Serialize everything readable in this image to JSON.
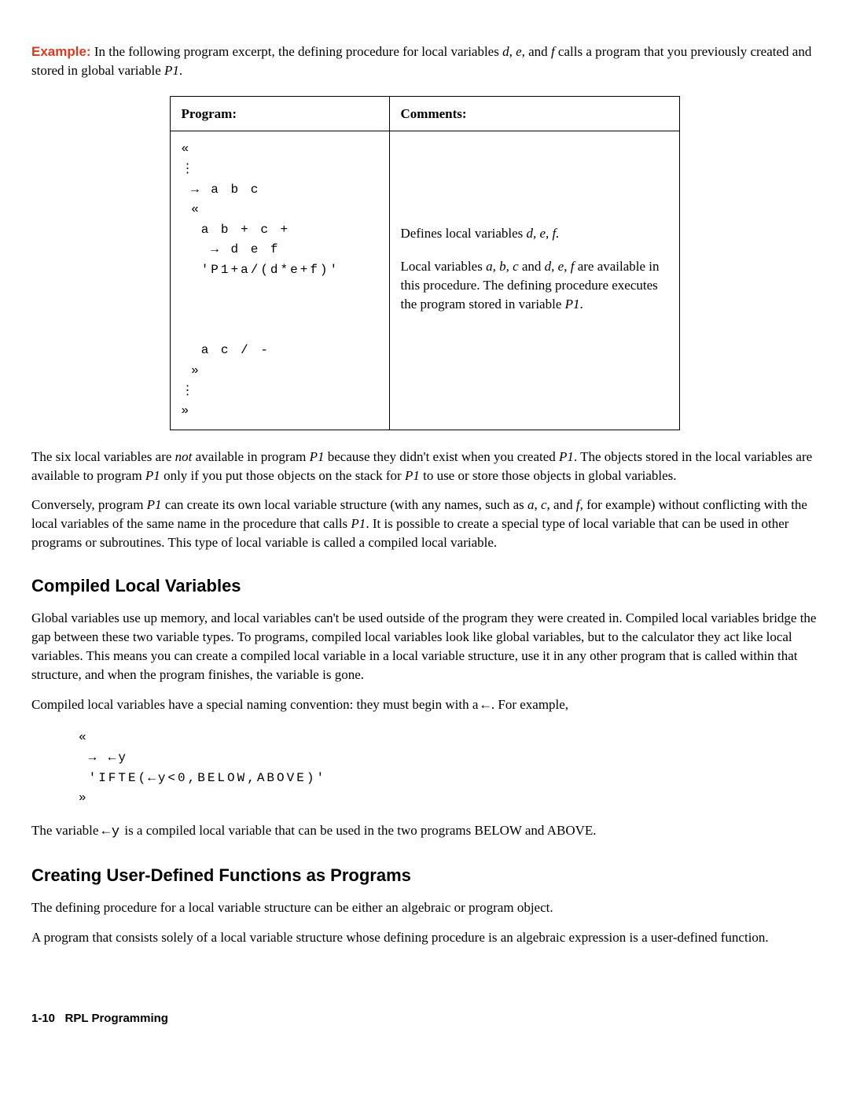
{
  "example": {
    "label": "Example:",
    "intro_1": " In the following program excerpt, the defining procedure for local variables ",
    "var_d": "d",
    "comma1": ", ",
    "var_e": "e",
    "comma2": ", and ",
    "var_f": "f",
    "intro_2": " calls a program that you previously created and stored in global variable ",
    "var_p1": "P1",
    "period": "."
  },
  "table": {
    "header_program": "Program:",
    "header_comments": "Comments:",
    "program_code": "«\n⋮\n → a b c\n «\n  a b + c +\n   → d e f\n  'P1+a/(d*e+f)'\n\n\n\n  a c / -\n »\n⋮\n»",
    "comment_line1_pre": "Defines local variables ",
    "comment_line1_vars": "d, e, f.",
    "comment_line2_pre": "Local variables ",
    "comment_line2_abc": "a, b, c",
    "comment_line2_mid": " and ",
    "comment_line2_def": "d, e, f",
    "comment_line2_post": " are available in this procedure. The defining procedure executes the program stored in variable ",
    "comment_line2_p1": "P1",
    "comment_line2_end": "."
  },
  "para1": {
    "t1": "The six local variables are ",
    "not": "not",
    "t2": " available in program ",
    "p1a": "P1",
    "t3": " because they didn't exist when you created ",
    "p1b": "P1",
    "t4": ". The objects stored in the local variables are available to program ",
    "p1c": "P1",
    "t5": " only if you put those objects on the stack for ",
    "p1d": "P1",
    "t6": " to use or store those objects in global variables."
  },
  "para2": {
    "t1": "Conversely, program ",
    "p1": "P1",
    "t2": " can create its own local variable structure (with any names, such as ",
    "va": "a",
    "c1": ", ",
    "vc": "c",
    "c2": ", and ",
    "vf": "f",
    "t3": ", for example) without conflicting with the local variables of the same name in the procedure that calls ",
    "p1b": "P1",
    "t4": ". It is possible to create a special type of local variable that can be used in other programs or subroutines. This type of local variable is called a compiled local variable."
  },
  "section1": {
    "heading": "Compiled Local Variables",
    "para1": "Global variables use up memory, and local variables can't be used outside of the program they were created in. Compiled local variables bridge the gap between these two variable types. To programs, compiled local variables look like global variables, but to the calculator they act like local variables. This means you can create a compiled local variable in a local variable structure, use it in any other program that is called within that structure, and when the program finishes, the variable is gone.",
    "para2_pre": "Compiled local variables have a special naming convention: they must begin with a ",
    "para2_sym": "←",
    "para2_post": ". For example,",
    "code": "«\n → ←y\n 'IFTE(←y<0,BELOW,ABOVE)'\n»",
    "para3_pre": "The variable ",
    "para3_var": "←y",
    "para3_post": " is a compiled local variable that can be used in the two programs BELOW and ABOVE."
  },
  "section2": {
    "heading": "Creating User-Defined Functions as Programs",
    "para1": "The defining procedure for a local variable structure can be either an algebraic or program object.",
    "para2": "A program that consists solely of a local variable structure whose defining procedure is an algebraic expression is a user-defined function."
  },
  "footer": {
    "page": "1-10",
    "title": "RPL Programming"
  }
}
